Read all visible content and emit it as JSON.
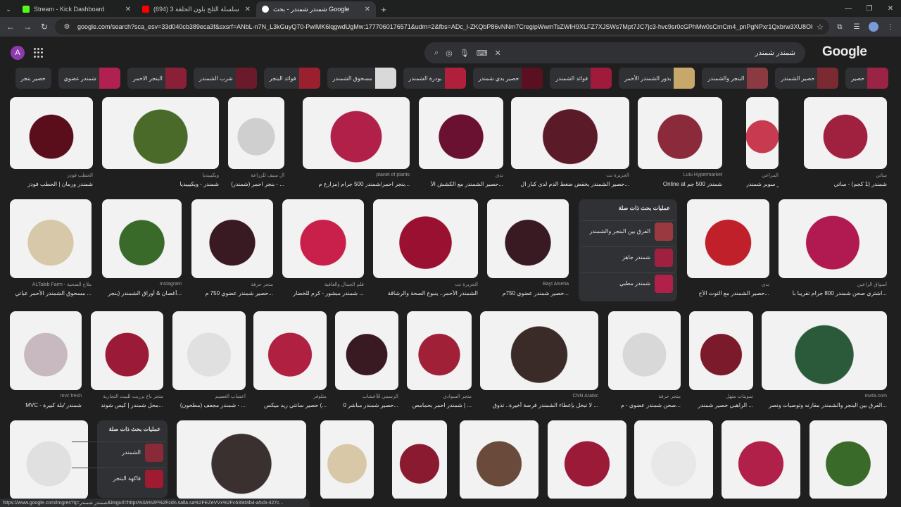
{
  "browser": {
    "tabs": [
      {
        "title": "Stream - Kick Dashboard",
        "color": "#53fc18"
      },
      {
        "title": "(694) سلسلة الثلج بلون الحلقة 3 -",
        "color": "#ff0000"
      },
      {
        "title": "شمندر شمندر - بحث Google",
        "color": "#ffffff"
      }
    ],
    "url": "google.com/search?sca_esv=33d040cb389eca3f&sxsrf=ANbL-n7N_L3kGuyQ70-PwlMK6lqgwdUgMw:1777060176571&udm=2&fbs=ADc_l-ZKQbP86vNNm7CregipWwmTsZWlH9XLFZ7XJSWs7Mpt7JC7jc3-hvc9sr0cGPhMw0sCmCm4_pnPgNPxr1Qxbrw3XU8OHul31a00..."
  },
  "header": {
    "avatar_letter": "A",
    "query": "شمندر شمندر",
    "logo": "Google"
  },
  "chips": [
    {
      "label": "حصير",
      "color": "#9b2345"
    },
    {
      "label": "حصير الشمندر",
      "color": "#7a2a30"
    },
    {
      "label": "البنجر والشمندر",
      "color": "#8a3a40"
    },
    {
      "label": "بذور الشمندر الأحمر",
      "color": "#c8a86a"
    },
    {
      "label": "فوائد الشمندر",
      "color": "#a01a3c"
    },
    {
      "label": "حصير بدي شمندر",
      "color": "#5a1020"
    },
    {
      "label": "بودرة الشمندر",
      "color": "#b0203a"
    },
    {
      "label": "مسحوق الشمندر",
      "color": "#d9d9d9"
    },
    {
      "label": "فوائد البنجر",
      "color": "#9a2030"
    },
    {
      "label": "شرب الشمندر",
      "color": "#6a1a2a"
    },
    {
      "label": "البنجر الاحمر",
      "color": "#8a2038"
    },
    {
      "label": "شمندر عضوي",
      "color": "#b02050"
    },
    {
      "label": "حصير بنجر",
      "color": "#303134"
    }
  ],
  "row1": [
    {
      "source": "ساتي",
      "title": "شمندر (1 كجم) - ساتي",
      "color": "#a02040"
    },
    {
      "source": "المراعي",
      "title": "حصير سوبر شمندر ...",
      "color": "#c83a50"
    },
    {
      "source": "Lulu Hypermarket",
      "title": "Online at شمندر 500 جم",
      "color": "#8a2a3a"
    },
    {
      "source": "الجزيرة نت",
      "title": "حصير الشمندر يخفض ضغط الدم لدى كبار ال...",
      "color": "#5a1a28"
    },
    {
      "source": "ندى",
      "title": "حصير الشمندر مع الكشش الأ...",
      "color": "#6a1030"
    },
    {
      "source": "planet of plants",
      "title": "بنجر احمر/شمندر 500 جرام (مزارع م...",
      "color": "#b02048"
    },
    {
      "source": "آل منيف للزراعة",
      "title": "بنجر احمر (شمندر) - ...",
      "color": "#cfcfcf"
    },
    {
      "source": "ويكيبيديا",
      "title": "شمندر - ويكيبيديا",
      "color": "#4a6a2a"
    },
    {
      "source": "الحطب فودز",
      "title": "شمندر ورمان | الحطب فودز",
      "color": "#5a0e1c"
    }
  ],
  "row2": [
    {
      "source": "أسواق الراعين",
      "title": "اشتري صحن شمندر 800 جرام تقريبا بأ...",
      "color": "#b01a50"
    },
    {
      "source": "ندى",
      "title": "حصير الشمندر مع التوت الأح...",
      "color": "#c0202a"
    },
    {
      "source": "Bayt Alseha",
      "title": "حصير شمندر عضوي 750م...",
      "color": "#3a1a22"
    },
    {
      "source": "الجزيرة نت",
      "title": "الشمندر الأحمر.. ينبوع الصحة والرشاقة",
      "color": "#9a1030"
    },
    {
      "source": "قلم الجمال والعافية",
      "title": "شمندر مبشور - كرم للخضار ...",
      "color": "#c8204a"
    },
    {
      "source": "متجر حرفة",
      "title": "حصير شمندر عضوي 750 م...",
      "color": "#3a1a22"
    },
    {
      "source": "Instagram",
      "title": "أغصان & أوراق الشمندر (بنجر...",
      "color": "#3a6a2a"
    },
    {
      "source": "ALTaleb Farm - ملاح الصحية",
      "title": "مسحوق الشمندر الأحمر عباتي ...",
      "color": "#d6c8a8"
    }
  ],
  "related1": {
    "heading": "عمليات بحث ذات صلة",
    "items": [
      {
        "label": "الفرق بين البنجر والشمندر",
        "color": "#9a3a40"
      },
      {
        "label": "شمندر جاهز",
        "color": "#a02040"
      },
      {
        "label": "شمندر مطبي",
        "color": "#b02048"
      }
    ]
  },
  "row3": [
    {
      "source": "invita.com",
      "title": "الفرق بين البنجر والشمندر مقارنه وتوصيات ونصر...",
      "color": "#2a5a3a"
    },
    {
      "source": "تموينات متهل",
      "title": "الراهبي حصير شمندر ...",
      "color": "#7a1a2a"
    },
    {
      "source": "متجر حرفة",
      "title": "صحن شمندر عضوي - م...",
      "color": "#d8d8d8"
    },
    {
      "source": "CNN Arabic",
      "title": "لا تبخل بإعطاء الشمندر فرصة أخيرة.. تذوق ...",
      "color": "#3a2a28"
    },
    {
      "source": "متجر السوادي",
      "title": "شمندر احمر بحمامص | ...",
      "color": "#a02038"
    },
    {
      "source": "الرسمي للأعشاب",
      "title": "حصير شمندر مباشر 0...",
      "color": "#3a1a22"
    },
    {
      "source": "متلوفر",
      "title": "حصير سانتي ريد ميكس (...",
      "color": "#b02040"
    },
    {
      "source": "أعشاب الغصيم",
      "title": "شمندر مجفف (مطحون) - ...",
      "color": "#e0e0e0"
    },
    {
      "source": "متجر باغ بزريت للبيت التجارية",
      "title": "محل شمندر | كيس شوند...",
      "color": "#9a1a38"
    },
    {
      "source": "mvc fresh",
      "title": "MVC - شمندر /بلة كبيرة",
      "color": "#c8b8c0"
    }
  ],
  "related2": {
    "heading": "عمليات بحث ذات صلة",
    "items": [
      {
        "label": "الشمندر",
        "color": "#8a2a38"
      },
      {
        "label": "فاكهة البنجر",
        "color": "#a01a30"
      }
    ]
  },
  "row4": [
    {
      "color": "#3a6a2a"
    },
    {
      "color": "#b02048"
    },
    {
      "color": "#e8e8e8"
    },
    {
      "color": "#9a1a38"
    },
    {
      "color": "#6a4a3a"
    },
    {
      "color": "#8a1a30"
    },
    {
      "color": "#d8c8a8"
    },
    {
      "color": "#3a3030"
    },
    {
      "color": "#e0e0e0"
    }
  ],
  "statusbar": "https://www.google.com/imgres?q=شمندر شمندر&imgurl=https%3A%2F%2Fcdn.salla.sa%2FEZeVVx%2Fc639d4b4-a5cb-427c..."
}
